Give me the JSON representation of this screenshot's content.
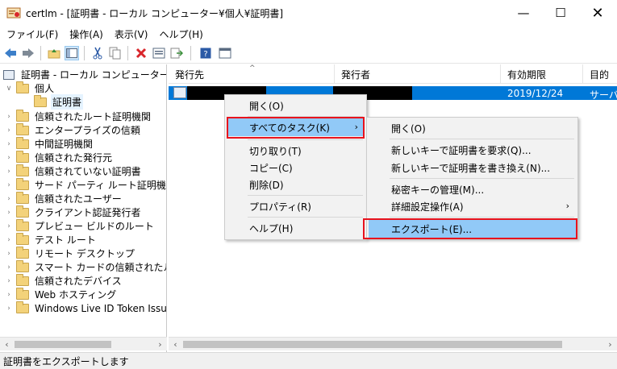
{
  "window": {
    "title": "certlm - [証明書 - ローカル コンピューター¥個人¥証明書]",
    "minimize_glyph": "—",
    "maximize_glyph": "☐",
    "close_glyph": "✕"
  },
  "menubar": {
    "items": [
      "ファイル(F)",
      "操作(A)",
      "表示(V)",
      "ヘルプ(H)"
    ]
  },
  "toolbar": {
    "icons": [
      "back-arrow-icon",
      "forward-arrow-icon",
      "up-folder-icon",
      "show-hide-tree-icon",
      "cut-icon",
      "copy-icon",
      "delete-icon",
      "properties-icon",
      "export-list-icon",
      "help-icon",
      "view-icon"
    ]
  },
  "tree": {
    "root": "証明書 - ローカル コンピューター",
    "personal": "個人",
    "certificates": "証明書",
    "items": [
      "信頼されたルート証明機関",
      "エンタープライズの信頼",
      "中間証明機関",
      "信頼された発行元",
      "信頼されていない証明書",
      "サード パーティ ルート証明機関",
      "信頼されたユーザー",
      "クライアント認証発行者",
      "プレビュー ビルドのルート",
      "テスト ルート",
      "リモート デスクトップ",
      "スマート カードの信頼されたルート",
      "信頼されたデバイス",
      "Web ホスティング",
      "Windows Live ID Token Issuer"
    ]
  },
  "list": {
    "columns": [
      "発行先",
      "発行者",
      "有効期限",
      "目的"
    ],
    "rows": [
      {
        "issued_to": "",
        "issued_by": "",
        "expires": "2019/12/24",
        "purpose": "サーバ"
      }
    ]
  },
  "context_menu": {
    "items": [
      "開く(O)",
      "すべてのタスク(K)",
      "切り取り(T)",
      "コピー(C)",
      "削除(D)",
      "プロパティ(R)",
      "ヘルプ(H)"
    ],
    "submenu_arrow": "›"
  },
  "submenu": {
    "items": [
      "開く(O)",
      "新しいキーで証明書を要求(Q)...",
      "新しいキーで証明書を書き換え(N)...",
      "秘密キーの管理(M)...",
      "詳細設定操作(A)",
      "エクスポート(E)..."
    ],
    "submenu_arrow": "›"
  },
  "statusbar": {
    "text": "証明書をエクスポートします"
  },
  "colors": {
    "selection": "#0078d7",
    "menu_highlight": "#91c9f7",
    "red_annotation": "#e8131d"
  }
}
